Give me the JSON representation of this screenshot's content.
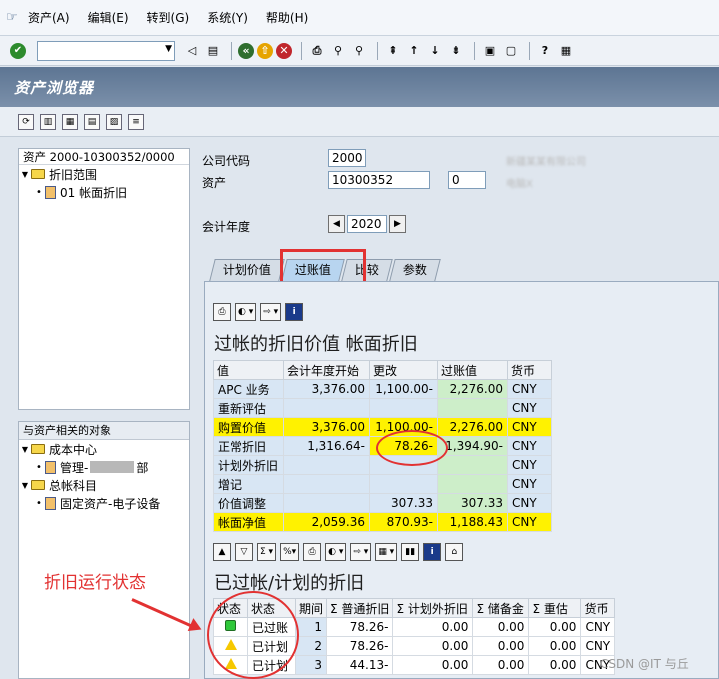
{
  "menu": {
    "items": [
      "资产(A)",
      "编辑(E)",
      "转到(G)",
      "系统(Y)",
      "帮助(H)"
    ]
  },
  "command_field": {
    "value": ""
  },
  "window_title": "资产浏览器",
  "tree": {
    "header": "资产 2000-10300352/0000",
    "node1": "折旧范围",
    "node2": "01 帐面折旧"
  },
  "related": {
    "header": "与资产相关的对象",
    "cost_center": "成本中心",
    "cost_center_child_pre": "管理-",
    "cost_center_child_post": "部",
    "gl": "总帐科目",
    "gl_child": "固定资产-电子设备"
  },
  "fields": {
    "company_code_label": "公司代码",
    "company_code_value": "2000",
    "company_desc": "新疆某某有限公司",
    "asset_label": "资产",
    "asset_value": "10300352",
    "asset_sub": "0",
    "asset_desc": "电脑X",
    "fiscal_year_label": "会计年度",
    "fiscal_year_value": "2020"
  },
  "tabs": [
    "计划价值",
    "过账值",
    "比较",
    "参数"
  ],
  "section1": {
    "title": "过帐的折旧价值 帐面折旧",
    "headers": [
      "值",
      "会计年度开始",
      "更改",
      "过账值",
      "货币"
    ],
    "rows": [
      {
        "label": "APC 业务",
        "start": "3,376.00",
        "change": "1,100.00-",
        "posted": "2,276.00",
        "cur": "CNY"
      },
      {
        "label": "重新评估",
        "start": "",
        "change": "",
        "posted": "",
        "cur": "CNY"
      },
      {
        "label": "购置价值",
        "start": "3,376.00",
        "change": "1,100.00-",
        "posted": "2,276.00",
        "cur": "CNY"
      },
      {
        "label": "正常折旧",
        "start": "1,316.64-",
        "change": "78.26-",
        "posted": "1,394.90-",
        "cur": "CNY"
      },
      {
        "label": "计划外折旧",
        "start": "",
        "change": "",
        "posted": "",
        "cur": "CNY"
      },
      {
        "label": "增记",
        "start": "",
        "change": "",
        "posted": "",
        "cur": "CNY"
      },
      {
        "label": "价值调整",
        "start": "",
        "change": "307.33",
        "posted": "307.33",
        "cur": "CNY"
      },
      {
        "label": "帐面净值",
        "start": "2,059.36",
        "change": "870.93-",
        "posted": "1,188.43",
        "cur": "CNY"
      }
    ]
  },
  "section2": {
    "title": "已过帐/计划的折旧",
    "headers": [
      "状态",
      "状态",
      "期间",
      "普通折旧",
      "计划外折旧",
      "储备金",
      "重估",
      "货币"
    ],
    "rows": [
      {
        "status": "已过账",
        "period": "1",
        "normal": "78.26-",
        "unplanned": "0.00",
        "reserve": "0.00",
        "reval": "0.00",
        "cur": "CNY"
      },
      {
        "status": "已计划",
        "period": "2",
        "normal": "78.26-",
        "unplanned": "0.00",
        "reserve": "0.00",
        "reval": "0.00",
        "cur": "CNY"
      },
      {
        "status": "已计划",
        "period": "3",
        "normal": "44.13-",
        "unplanned": "0.00",
        "reserve": "0.00",
        "reval": "0.00",
        "cur": "CNY"
      }
    ]
  },
  "annotation": "折旧运行状态",
  "watermark": "CSDN @IT 与丘"
}
